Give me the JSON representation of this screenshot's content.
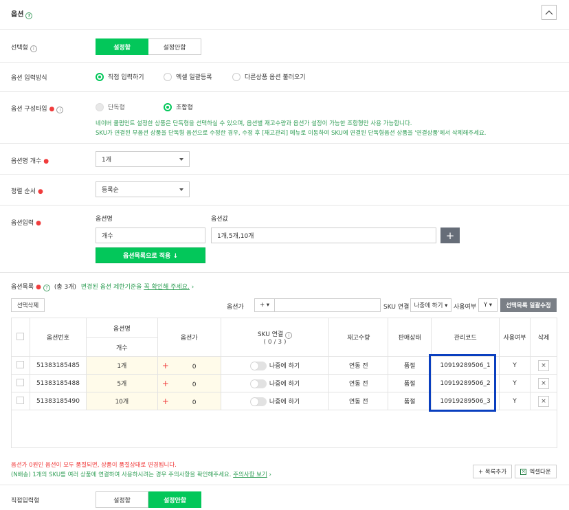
{
  "header": {
    "title": "옵션",
    "collapse_icon": "chevron-up-icon"
  },
  "select_type": {
    "label": "선택형",
    "on": "설정함",
    "off": "설정안함"
  },
  "input_method": {
    "label": "옵션 입력방식",
    "options": [
      "직접 입력하기",
      "엑셀 일괄등록",
      "다른상품 옵션 불러오기"
    ]
  },
  "option_type": {
    "label": "옵션 구성타입",
    "options": [
      "단독형",
      "조합형"
    ],
    "note1": "네이버 쿨펌먼트 설정한 상품은 단독형을 선택하실 수 있으며, 옵션별 재고수량과 옵션가 설정이 가능한 조합형만 사용 가능합니다.",
    "note2": "SKU가 연결된 무옵션 상품을 단독형 옵션으로 수정한 경우, 수정 후 [재고관리] 메뉴로 이동하여 SKU에 연결된 단독형옵션 상품을 '연결상품'에서 삭제해주세요."
  },
  "option_count": {
    "label": "옵션명 개수",
    "value": "1개"
  },
  "sort_order": {
    "label": "정렬 순서",
    "value": "등록순"
  },
  "option_input": {
    "label": "옵션입력",
    "name_header": "옵션명",
    "value_header": "옵션값",
    "name_value": "개수",
    "value_value": "1개,5개,10개",
    "apply_button": "옵션목록으로 적용 ↓"
  },
  "option_list": {
    "label": "옵션목록",
    "count": "(총 3개)",
    "notice_prefix": "변경된 옵션 제한기준을",
    "notice_link": "꼭 확인해 주세요.",
    "notice_arrow": "›",
    "delete_selected": "선택삭제",
    "price_label": "옵션가",
    "price_sign": "+ ▾",
    "sku_label": "SKU 연결",
    "sku_select": "나중에 하기 ▾",
    "use_label": "사용여부",
    "use_select": "Y ▾",
    "bulk_edit": "선택목록 일괄수정"
  },
  "table": {
    "headers": {
      "option_no": "옵션번호",
      "option_name": "옵션명",
      "option_sub": "개수",
      "price": "옵션가",
      "sku": "SKU 연결",
      "stock": "재고수량",
      "sale_status": "판매상태",
      "mgmt_code": "관리코드",
      "use": "사용여부",
      "delete": "삭제"
    },
    "rows": [
      {
        "no": "51383185485",
        "name": "1개",
        "price": "0",
        "sku": "나중에 하기",
        "stock": "연동 전",
        "status": "품절",
        "code": "10919289506_1",
        "use": "Y"
      },
      {
        "no": "51383185488",
        "name": "5개",
        "price": "0",
        "sku": "나중에 하기",
        "stock": "연동 전",
        "status": "품절",
        "code": "10919289506_2",
        "use": "Y"
      },
      {
        "no": "51383185490",
        "name": "10개",
        "price": "0",
        "sku": "나중에 하기",
        "stock": "연동 전",
        "status": "품절",
        "code": "10919289506_3",
        "use": "Y"
      }
    ],
    "sku_count": "( 0 / 3 )"
  },
  "footer": {
    "warn": "옵션가 0원인 옵션이 모두 품절되면, 상품이 품절상태로 변경됩니다.",
    "note_prefix": "(N배송) 1개의 SKU를 여러 상품에 연결하여 사용하시려는 경우 주의사항을 확인해주세요.",
    "note_link": "주의사항 보기",
    "note_arrow": "›",
    "add_button": "+ 목록추가",
    "excel_button": "엑셀다운"
  },
  "direct_input": {
    "label": "직접입력형",
    "on": "설정함",
    "off": "설정안함"
  },
  "colors": {
    "accent": "#03c75a",
    "highlight": "#0a3fbf",
    "warn": "#f03c3c",
    "note": "#2f9e55"
  }
}
